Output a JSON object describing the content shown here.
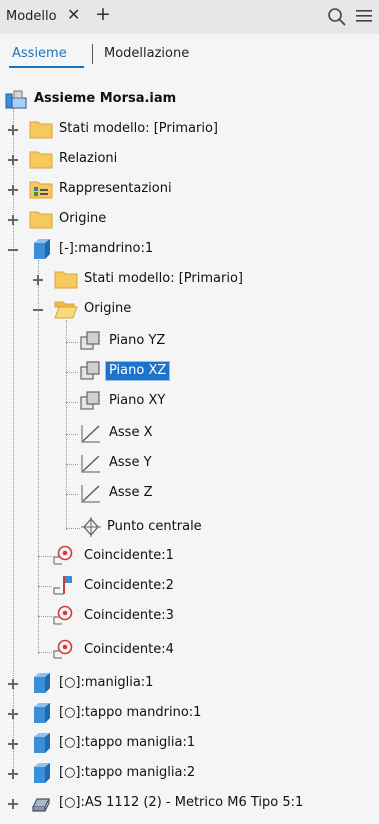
{
  "header": {
    "panel_title": "Modello",
    "close_glyph": "✕",
    "add_glyph": "+",
    "icons": [
      "search-icon",
      "menu-icon"
    ]
  },
  "subtabs": {
    "items": [
      "Assieme",
      "Modellazione"
    ],
    "active": "Assieme"
  },
  "tree": {
    "root": "Assieme Morsa.iam",
    "items": [
      {
        "label": "Stati modello: [Primario]",
        "icon": "folder-icon",
        "level": 1,
        "toggle": "plus"
      },
      {
        "label": "Relazioni",
        "icon": "folder-icon",
        "level": 1,
        "toggle": "plus"
      },
      {
        "label": "Rappresentazioni",
        "icon": "representations-folder-icon",
        "level": 1,
        "toggle": "plus"
      },
      {
        "label": "Origine",
        "icon": "folder-icon",
        "level": 1,
        "toggle": "plus"
      },
      {
        "label": "[-]:mandrino:1",
        "icon": "part-icon",
        "level": 1,
        "toggle": "minus"
      },
      {
        "label": "Stati modello: [Primario]",
        "icon": "folder-icon",
        "level": 2,
        "toggle": "plus"
      },
      {
        "label": "Origine",
        "icon": "open-folder-icon",
        "level": 2,
        "toggle": "minus"
      },
      {
        "label": "Piano YZ",
        "icon": "work-plane-icon",
        "level": 3
      },
      {
        "label": "Piano XZ",
        "icon": "work-plane-icon",
        "level": 3,
        "selected": true
      },
      {
        "label": "Piano XY",
        "icon": "work-plane-icon",
        "level": 3
      },
      {
        "label": "Asse X",
        "icon": "work-axis-icon",
        "level": 3
      },
      {
        "label": "Asse Y",
        "icon": "work-axis-icon",
        "level": 3
      },
      {
        "label": "Asse Z",
        "icon": "work-axis-icon",
        "level": 3
      },
      {
        "label": "Punto centrale",
        "icon": "work-point-icon",
        "level": 3
      },
      {
        "label": "Coincidente:1",
        "icon": "mate-constraint-icon",
        "level": 2
      },
      {
        "label": "Coincidente:2",
        "icon": "flush-constraint-icon",
        "level": 2
      },
      {
        "label": "Coincidente:3",
        "icon": "mate-constraint-icon",
        "level": 2
      },
      {
        "label": "Coincidente:4",
        "icon": "mate-constraint-icon",
        "level": 2
      },
      {
        "label": "[○]:maniglia:1",
        "icon": "part-icon",
        "level": 1,
        "toggle": "plus"
      },
      {
        "label": "[○]:tappo mandrino:1",
        "icon": "part-icon",
        "level": 1,
        "toggle": "plus"
      },
      {
        "label": "[○]:tappo maniglia:1",
        "icon": "part-icon",
        "level": 1,
        "toggle": "plus"
      },
      {
        "label": "[○]:tappo maniglia:2",
        "icon": "part-icon",
        "level": 1,
        "toggle": "plus"
      },
      {
        "label": "[○]:AS 1112 (2) - Metrico M6  Tipo 5:1",
        "icon": "fastener-icon",
        "level": 1,
        "toggle": "plus"
      }
    ]
  },
  "colors": {
    "accent": "#1e73be",
    "selection": "#1e73c8",
    "folder": "#f6c95a",
    "part": "#3a8fd8"
  }
}
